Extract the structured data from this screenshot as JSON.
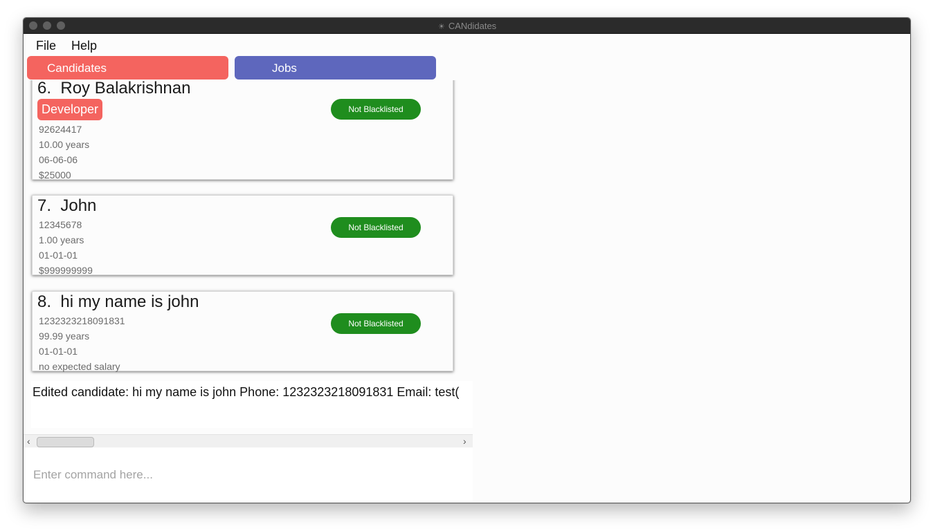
{
  "window": {
    "title": "CANdidates",
    "app_icon": "candidates-app-icon"
  },
  "menu": {
    "file": "File",
    "help": "Help"
  },
  "tabs": {
    "candidates": "Candidates",
    "jobs": "Jobs",
    "colors": {
      "candidates": "#f4645f",
      "jobs": "#5e67bd"
    }
  },
  "candidates": [
    {
      "index": "6.",
      "name": "Roy Balakrishnan",
      "tag": "Developer",
      "phone": "92624417",
      "experience": "10.00 years",
      "date": "06-06-06",
      "salary": "$25000",
      "status": "Not Blacklisted"
    },
    {
      "index": "7.",
      "name": "John",
      "phone": "12345678",
      "experience": "1.00 years",
      "date": "01-01-01",
      "salary": "$999999999",
      "status": "Not Blacklisted"
    },
    {
      "index": "8.",
      "name": "hi my name is john",
      "phone": "1232323218091831",
      "experience": "99.99 years",
      "date": "01-01-01",
      "salary": "no expected salary",
      "status": "Not Blacklisted"
    }
  ],
  "status_color": "#1f8d1e",
  "result": {
    "text": "Edited candidate: hi my name is john Phone: 1232323218091831 Email: test("
  },
  "scroll": {
    "left_icon": "chevron-left-icon",
    "right_icon": "chevron-right-icon",
    "left_glyph": "‹",
    "right_glyph": "›"
  },
  "command": {
    "placeholder": "Enter command here..."
  }
}
